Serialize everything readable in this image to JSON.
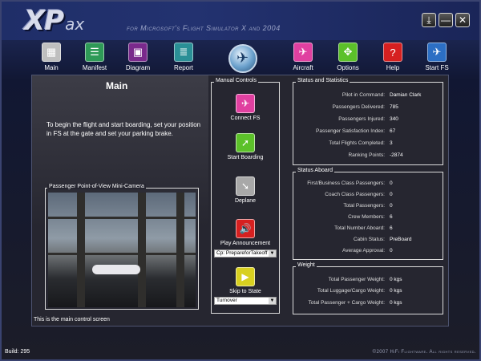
{
  "app": {
    "logo_main": "XP",
    "logo_sub": "ax",
    "tagline": "for Microsoft's Flight Simulator X and 2004"
  },
  "window_controls": {
    "download_icon": "download-icon",
    "minimize": "—",
    "close": "✕"
  },
  "toolbar": [
    {
      "label": "Main",
      "icon": "main-icon",
      "color": "#bfbfbf"
    },
    {
      "label": "Manifest",
      "icon": "manifest-icon",
      "color": "#2e9a57"
    },
    {
      "label": "Diagram",
      "icon": "diagram-icon",
      "color": "#7a2a8c"
    },
    {
      "label": "Report",
      "icon": "report-icon",
      "color": "#2a8f96"
    },
    {
      "label": "Aircraft",
      "icon": "aircraft-icon",
      "color": "#e040a0"
    },
    {
      "label": "Options",
      "icon": "options-icon",
      "color": "#5cc12a"
    },
    {
      "label": "Help",
      "icon": "help-icon",
      "color": "#d62020"
    },
    {
      "label": "Start FS",
      "icon": "start-fs-icon",
      "color": "#2c6fc4"
    }
  ],
  "main": {
    "title": "Main",
    "intro": "To begin the flight and start boarding, set your position in FS at the gate and set your parking brake.",
    "camera_caption": "Passenger Point-of-View Mini-Camera",
    "status_line": "This is the main control screen"
  },
  "manual_controls": {
    "caption": "Manual Controls",
    "connect": "Connect FS",
    "start_boarding": "Start Boarding",
    "deplane": "Deplane",
    "play_announcement": "Play Announcement",
    "announcement_value": "Cp: PrepareforTakeoff",
    "skip_to_state": "Skip to State",
    "state_value": "Turnover"
  },
  "status_statistics": {
    "caption": "Status and Statistics",
    "rows": [
      {
        "k": "Pilot in Command:",
        "v": "Damian Clark"
      },
      {
        "k": "Passengers Delivered:",
        "v": "785"
      },
      {
        "k": "Passengers Injured:",
        "v": "340"
      },
      {
        "k": "Passenger Satisfaction Index:",
        "v": "67"
      },
      {
        "k": "Total Flights Completed:",
        "v": "3"
      },
      {
        "k": "Ranking Points:",
        "v": "-2874"
      }
    ]
  },
  "status_aboard": {
    "caption": "Status Aboard",
    "rows": [
      {
        "k": "First/Business Class Passengers:",
        "v": "0"
      },
      {
        "k": "Coach Class Passengers:",
        "v": "0"
      },
      {
        "k": "Total Passengers:",
        "v": "0"
      },
      {
        "k": "Crew Members:",
        "v": "6"
      },
      {
        "k": "Total Number Aboard:",
        "v": "6"
      },
      {
        "k": "Cabin Status:",
        "v": "PreBoard"
      },
      {
        "k": "Average Approval:",
        "v": "0"
      }
    ]
  },
  "weight": {
    "caption": "Weight",
    "rows": [
      {
        "k": "Total Passenger Weight:",
        "v": "0 kgs"
      },
      {
        "k": "Total Luggage/Cargo Weight:",
        "v": "0 kgs"
      },
      {
        "k": "Total Passenger + Cargo Weight:",
        "v": "0 kgs"
      }
    ]
  },
  "footer": {
    "build": "Build: 295",
    "copyright": "©2007 HiFi Flightware. All rights reserved."
  }
}
